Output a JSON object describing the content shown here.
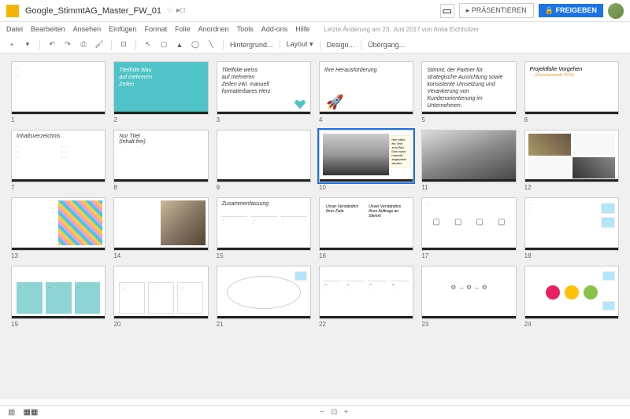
{
  "header": {
    "title": "Google_StimmtAG_Master_FW_01",
    "present": "PRÄSENTIEREN",
    "share": "FREIGEBEN"
  },
  "menu": {
    "items": [
      "Datei",
      "Bearbeiten",
      "Ansehen",
      "Einfügen",
      "Format",
      "Folie",
      "Anordnen",
      "Tools",
      "Add-ons",
      "Hilfe"
    ],
    "lastmod": "Letzte Änderung am 23. Juni 2017 von Anita Eichholzer"
  },
  "toolbar": {
    "bg": "Hintergrund...",
    "layout": "Layout ▾",
    "design": "Design...",
    "trans": "Übergang..."
  },
  "slides": [
    {
      "n": "1",
      "type": "cover",
      "txt": ""
    },
    {
      "n": "2",
      "type": "blue",
      "txt": "Titelfolie blau\nauf mehreren\nZeilen"
    },
    {
      "n": "3",
      "type": "white",
      "txt": "Titelfolie weiss\nauf mehreren\nZeilen inkl. manuell\nformatierbares Herz"
    },
    {
      "n": "4",
      "type": "rocket",
      "txt": "Ihre Herausforderung"
    },
    {
      "n": "5",
      "type": "text",
      "txt": "Stimmt, der Partner für\nstrategische Ausrichtung sowie\nkonsistente Umsetzung und\nVerankerung von\nKundenorientierung im\nUnternehmen."
    },
    {
      "n": "6",
      "type": "proj",
      "txt": "Projektfolie Vorgehen",
      "sub": "— (Zwischenrunde 2015)"
    },
    {
      "n": "7",
      "type": "toc",
      "txt": "Inhaltsverzeichnis"
    },
    {
      "n": "8",
      "type": "title",
      "txt": "Nur Titel\n(Inhalt frei)"
    },
    {
      "n": "9",
      "type": "small",
      "txt": ""
    },
    {
      "n": "10",
      "type": "car",
      "txt": "Hier steht ein Text\nzum Bild. Das muss\nmanuell angepasst\nwerden",
      "sel": true
    },
    {
      "n": "11",
      "type": "img",
      "txt": ""
    },
    {
      "n": "12",
      "type": "collage",
      "txt": ""
    },
    {
      "n": "13",
      "type": "sticky",
      "txt": ""
    },
    {
      "n": "14",
      "type": "hands",
      "txt": ""
    },
    {
      "n": "15",
      "type": "zus",
      "txt": "Zusammenfassung"
    },
    {
      "n": "16",
      "type": "two",
      "a": "Unser Verständnis\nIhrer Ziele",
      "b": "Unser Verständnis\nIhres Auftrags an\nStimmt"
    },
    {
      "n": "17",
      "type": "icons",
      "txt": ""
    },
    {
      "n": "18",
      "type": "notes",
      "txt": ""
    },
    {
      "n": "19",
      "type": "cards",
      "txt": ""
    },
    {
      "n": "20",
      "type": "cards2",
      "txt": ""
    },
    {
      "n": "21",
      "type": "circle",
      "txt": ""
    },
    {
      "n": "22",
      "type": "cols",
      "txt": ""
    },
    {
      "n": "23",
      "type": "flow",
      "txt": ""
    },
    {
      "n": "24",
      "type": "bubbles",
      "txt": ""
    }
  ],
  "zoom": {
    "minus": "−",
    "reset": "⊡",
    "plus": "+"
  }
}
